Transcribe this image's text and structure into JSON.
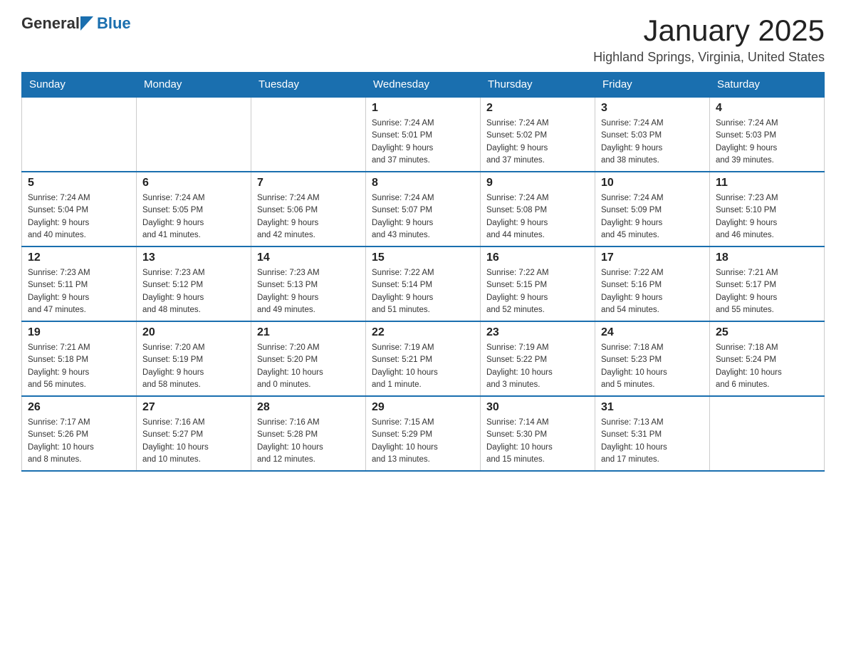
{
  "header": {
    "logo_general": "General",
    "logo_blue": "Blue",
    "title": "January 2025",
    "subtitle": "Highland Springs, Virginia, United States"
  },
  "days_of_week": [
    "Sunday",
    "Monday",
    "Tuesday",
    "Wednesday",
    "Thursday",
    "Friday",
    "Saturday"
  ],
  "weeks": [
    [
      {
        "day": "",
        "info": ""
      },
      {
        "day": "",
        "info": ""
      },
      {
        "day": "",
        "info": ""
      },
      {
        "day": "1",
        "info": "Sunrise: 7:24 AM\nSunset: 5:01 PM\nDaylight: 9 hours\nand 37 minutes."
      },
      {
        "day": "2",
        "info": "Sunrise: 7:24 AM\nSunset: 5:02 PM\nDaylight: 9 hours\nand 37 minutes."
      },
      {
        "day": "3",
        "info": "Sunrise: 7:24 AM\nSunset: 5:03 PM\nDaylight: 9 hours\nand 38 minutes."
      },
      {
        "day": "4",
        "info": "Sunrise: 7:24 AM\nSunset: 5:03 PM\nDaylight: 9 hours\nand 39 minutes."
      }
    ],
    [
      {
        "day": "5",
        "info": "Sunrise: 7:24 AM\nSunset: 5:04 PM\nDaylight: 9 hours\nand 40 minutes."
      },
      {
        "day": "6",
        "info": "Sunrise: 7:24 AM\nSunset: 5:05 PM\nDaylight: 9 hours\nand 41 minutes."
      },
      {
        "day": "7",
        "info": "Sunrise: 7:24 AM\nSunset: 5:06 PM\nDaylight: 9 hours\nand 42 minutes."
      },
      {
        "day": "8",
        "info": "Sunrise: 7:24 AM\nSunset: 5:07 PM\nDaylight: 9 hours\nand 43 minutes."
      },
      {
        "day": "9",
        "info": "Sunrise: 7:24 AM\nSunset: 5:08 PM\nDaylight: 9 hours\nand 44 minutes."
      },
      {
        "day": "10",
        "info": "Sunrise: 7:24 AM\nSunset: 5:09 PM\nDaylight: 9 hours\nand 45 minutes."
      },
      {
        "day": "11",
        "info": "Sunrise: 7:23 AM\nSunset: 5:10 PM\nDaylight: 9 hours\nand 46 minutes."
      }
    ],
    [
      {
        "day": "12",
        "info": "Sunrise: 7:23 AM\nSunset: 5:11 PM\nDaylight: 9 hours\nand 47 minutes."
      },
      {
        "day": "13",
        "info": "Sunrise: 7:23 AM\nSunset: 5:12 PM\nDaylight: 9 hours\nand 48 minutes."
      },
      {
        "day": "14",
        "info": "Sunrise: 7:23 AM\nSunset: 5:13 PM\nDaylight: 9 hours\nand 49 minutes."
      },
      {
        "day": "15",
        "info": "Sunrise: 7:22 AM\nSunset: 5:14 PM\nDaylight: 9 hours\nand 51 minutes."
      },
      {
        "day": "16",
        "info": "Sunrise: 7:22 AM\nSunset: 5:15 PM\nDaylight: 9 hours\nand 52 minutes."
      },
      {
        "day": "17",
        "info": "Sunrise: 7:22 AM\nSunset: 5:16 PM\nDaylight: 9 hours\nand 54 minutes."
      },
      {
        "day": "18",
        "info": "Sunrise: 7:21 AM\nSunset: 5:17 PM\nDaylight: 9 hours\nand 55 minutes."
      }
    ],
    [
      {
        "day": "19",
        "info": "Sunrise: 7:21 AM\nSunset: 5:18 PM\nDaylight: 9 hours\nand 56 minutes."
      },
      {
        "day": "20",
        "info": "Sunrise: 7:20 AM\nSunset: 5:19 PM\nDaylight: 9 hours\nand 58 minutes."
      },
      {
        "day": "21",
        "info": "Sunrise: 7:20 AM\nSunset: 5:20 PM\nDaylight: 10 hours\nand 0 minutes."
      },
      {
        "day": "22",
        "info": "Sunrise: 7:19 AM\nSunset: 5:21 PM\nDaylight: 10 hours\nand 1 minute."
      },
      {
        "day": "23",
        "info": "Sunrise: 7:19 AM\nSunset: 5:22 PM\nDaylight: 10 hours\nand 3 minutes."
      },
      {
        "day": "24",
        "info": "Sunrise: 7:18 AM\nSunset: 5:23 PM\nDaylight: 10 hours\nand 5 minutes."
      },
      {
        "day": "25",
        "info": "Sunrise: 7:18 AM\nSunset: 5:24 PM\nDaylight: 10 hours\nand 6 minutes."
      }
    ],
    [
      {
        "day": "26",
        "info": "Sunrise: 7:17 AM\nSunset: 5:26 PM\nDaylight: 10 hours\nand 8 minutes."
      },
      {
        "day": "27",
        "info": "Sunrise: 7:16 AM\nSunset: 5:27 PM\nDaylight: 10 hours\nand 10 minutes."
      },
      {
        "day": "28",
        "info": "Sunrise: 7:16 AM\nSunset: 5:28 PM\nDaylight: 10 hours\nand 12 minutes."
      },
      {
        "day": "29",
        "info": "Sunrise: 7:15 AM\nSunset: 5:29 PM\nDaylight: 10 hours\nand 13 minutes."
      },
      {
        "day": "30",
        "info": "Sunrise: 7:14 AM\nSunset: 5:30 PM\nDaylight: 10 hours\nand 15 minutes."
      },
      {
        "day": "31",
        "info": "Sunrise: 7:13 AM\nSunset: 5:31 PM\nDaylight: 10 hours\nand 17 minutes."
      },
      {
        "day": "",
        "info": ""
      }
    ]
  ]
}
